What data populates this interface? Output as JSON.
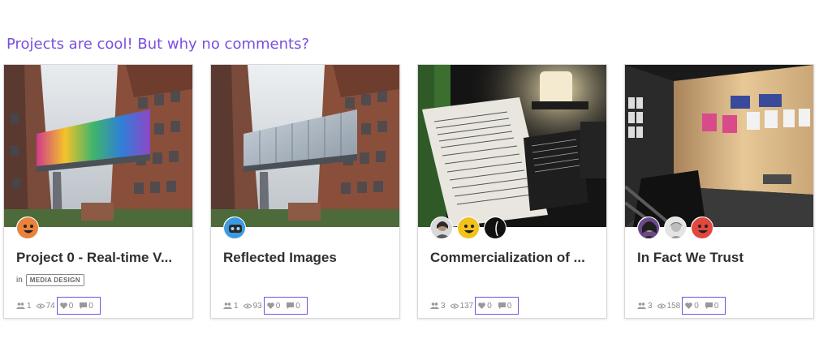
{
  "heading": "Projects are cool! But why no comments?",
  "cards": [
    {
      "title": "Project 0 - Real-time V...",
      "in_label": "in",
      "category": "MEDIA DESIGN",
      "image": "building-with-colorful-skybridge",
      "avatars": [
        "smiley-orange-avatar"
      ],
      "members": "1",
      "views": "74",
      "likes": "0",
      "comments": "0"
    },
    {
      "title": "Reflected Images",
      "image": "building-with-glass-skybridge",
      "avatars": [
        "robot-blue-avatar"
      ],
      "members": "1",
      "views": "93",
      "likes": "0",
      "comments": "0"
    },
    {
      "title": "Commercialization of ...",
      "image": "exhibit-panel-with-lamp",
      "avatars": [
        "user-photo-avatar",
        "smiley-yellow-avatar",
        "user-photo-dark-avatar"
      ],
      "members": "3",
      "views": "137",
      "likes": "0",
      "comments": "0"
    },
    {
      "title": "In Fact We Trust",
      "image": "gallery-room-with-posters",
      "avatars": [
        "user-photo-avatar",
        "user-photo-grey-avatar",
        "smiley-red-avatar"
      ],
      "members": "3",
      "views": "158",
      "likes": "0",
      "comments": "0"
    }
  ],
  "colors": {
    "accent": "#7a4ee0",
    "smiley_orange": "#e9823a",
    "robot_blue": "#3b9be0",
    "smiley_yellow": "#f2c21b",
    "smiley_red": "#e2483d"
  }
}
